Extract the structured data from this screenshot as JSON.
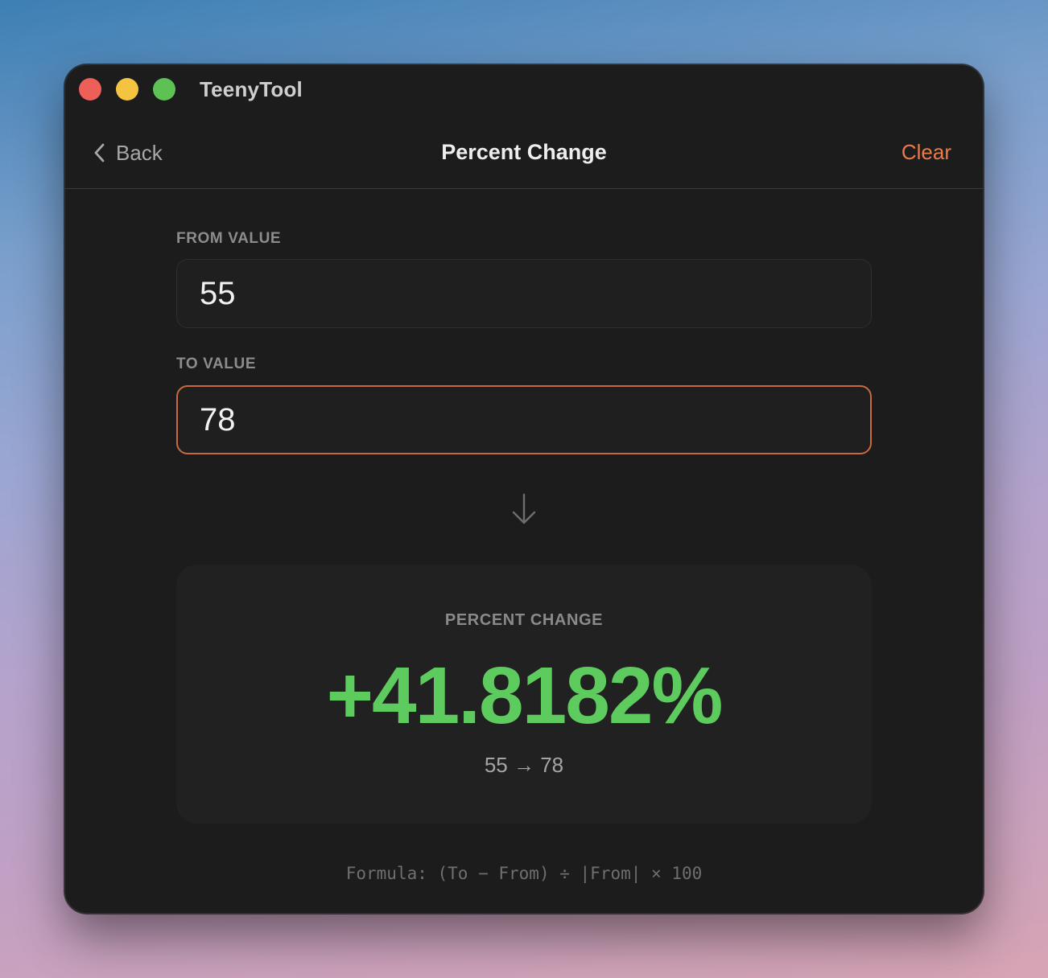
{
  "window": {
    "app_title": "TeenyTool"
  },
  "nav": {
    "back_label": "Back",
    "title": "Percent Change",
    "clear_label": "Clear"
  },
  "form": {
    "from": {
      "label": "FROM VALUE",
      "value": "55"
    },
    "to": {
      "label": "TO VALUE",
      "value": "78"
    }
  },
  "result": {
    "label": "PERCENT CHANGE",
    "value": "+41.8182%",
    "summary": "55 → 78"
  },
  "footer": {
    "formula": "Formula: (To − From) ÷ |From| × 100"
  },
  "colors": {
    "accent": "#ee7a47",
    "focus_border": "#c86a3e",
    "positive": "#5ecb5e",
    "window_bg": "#1c1c1c"
  },
  "icons": [
    "chevron-left-icon",
    "arrow-down-icon"
  ]
}
